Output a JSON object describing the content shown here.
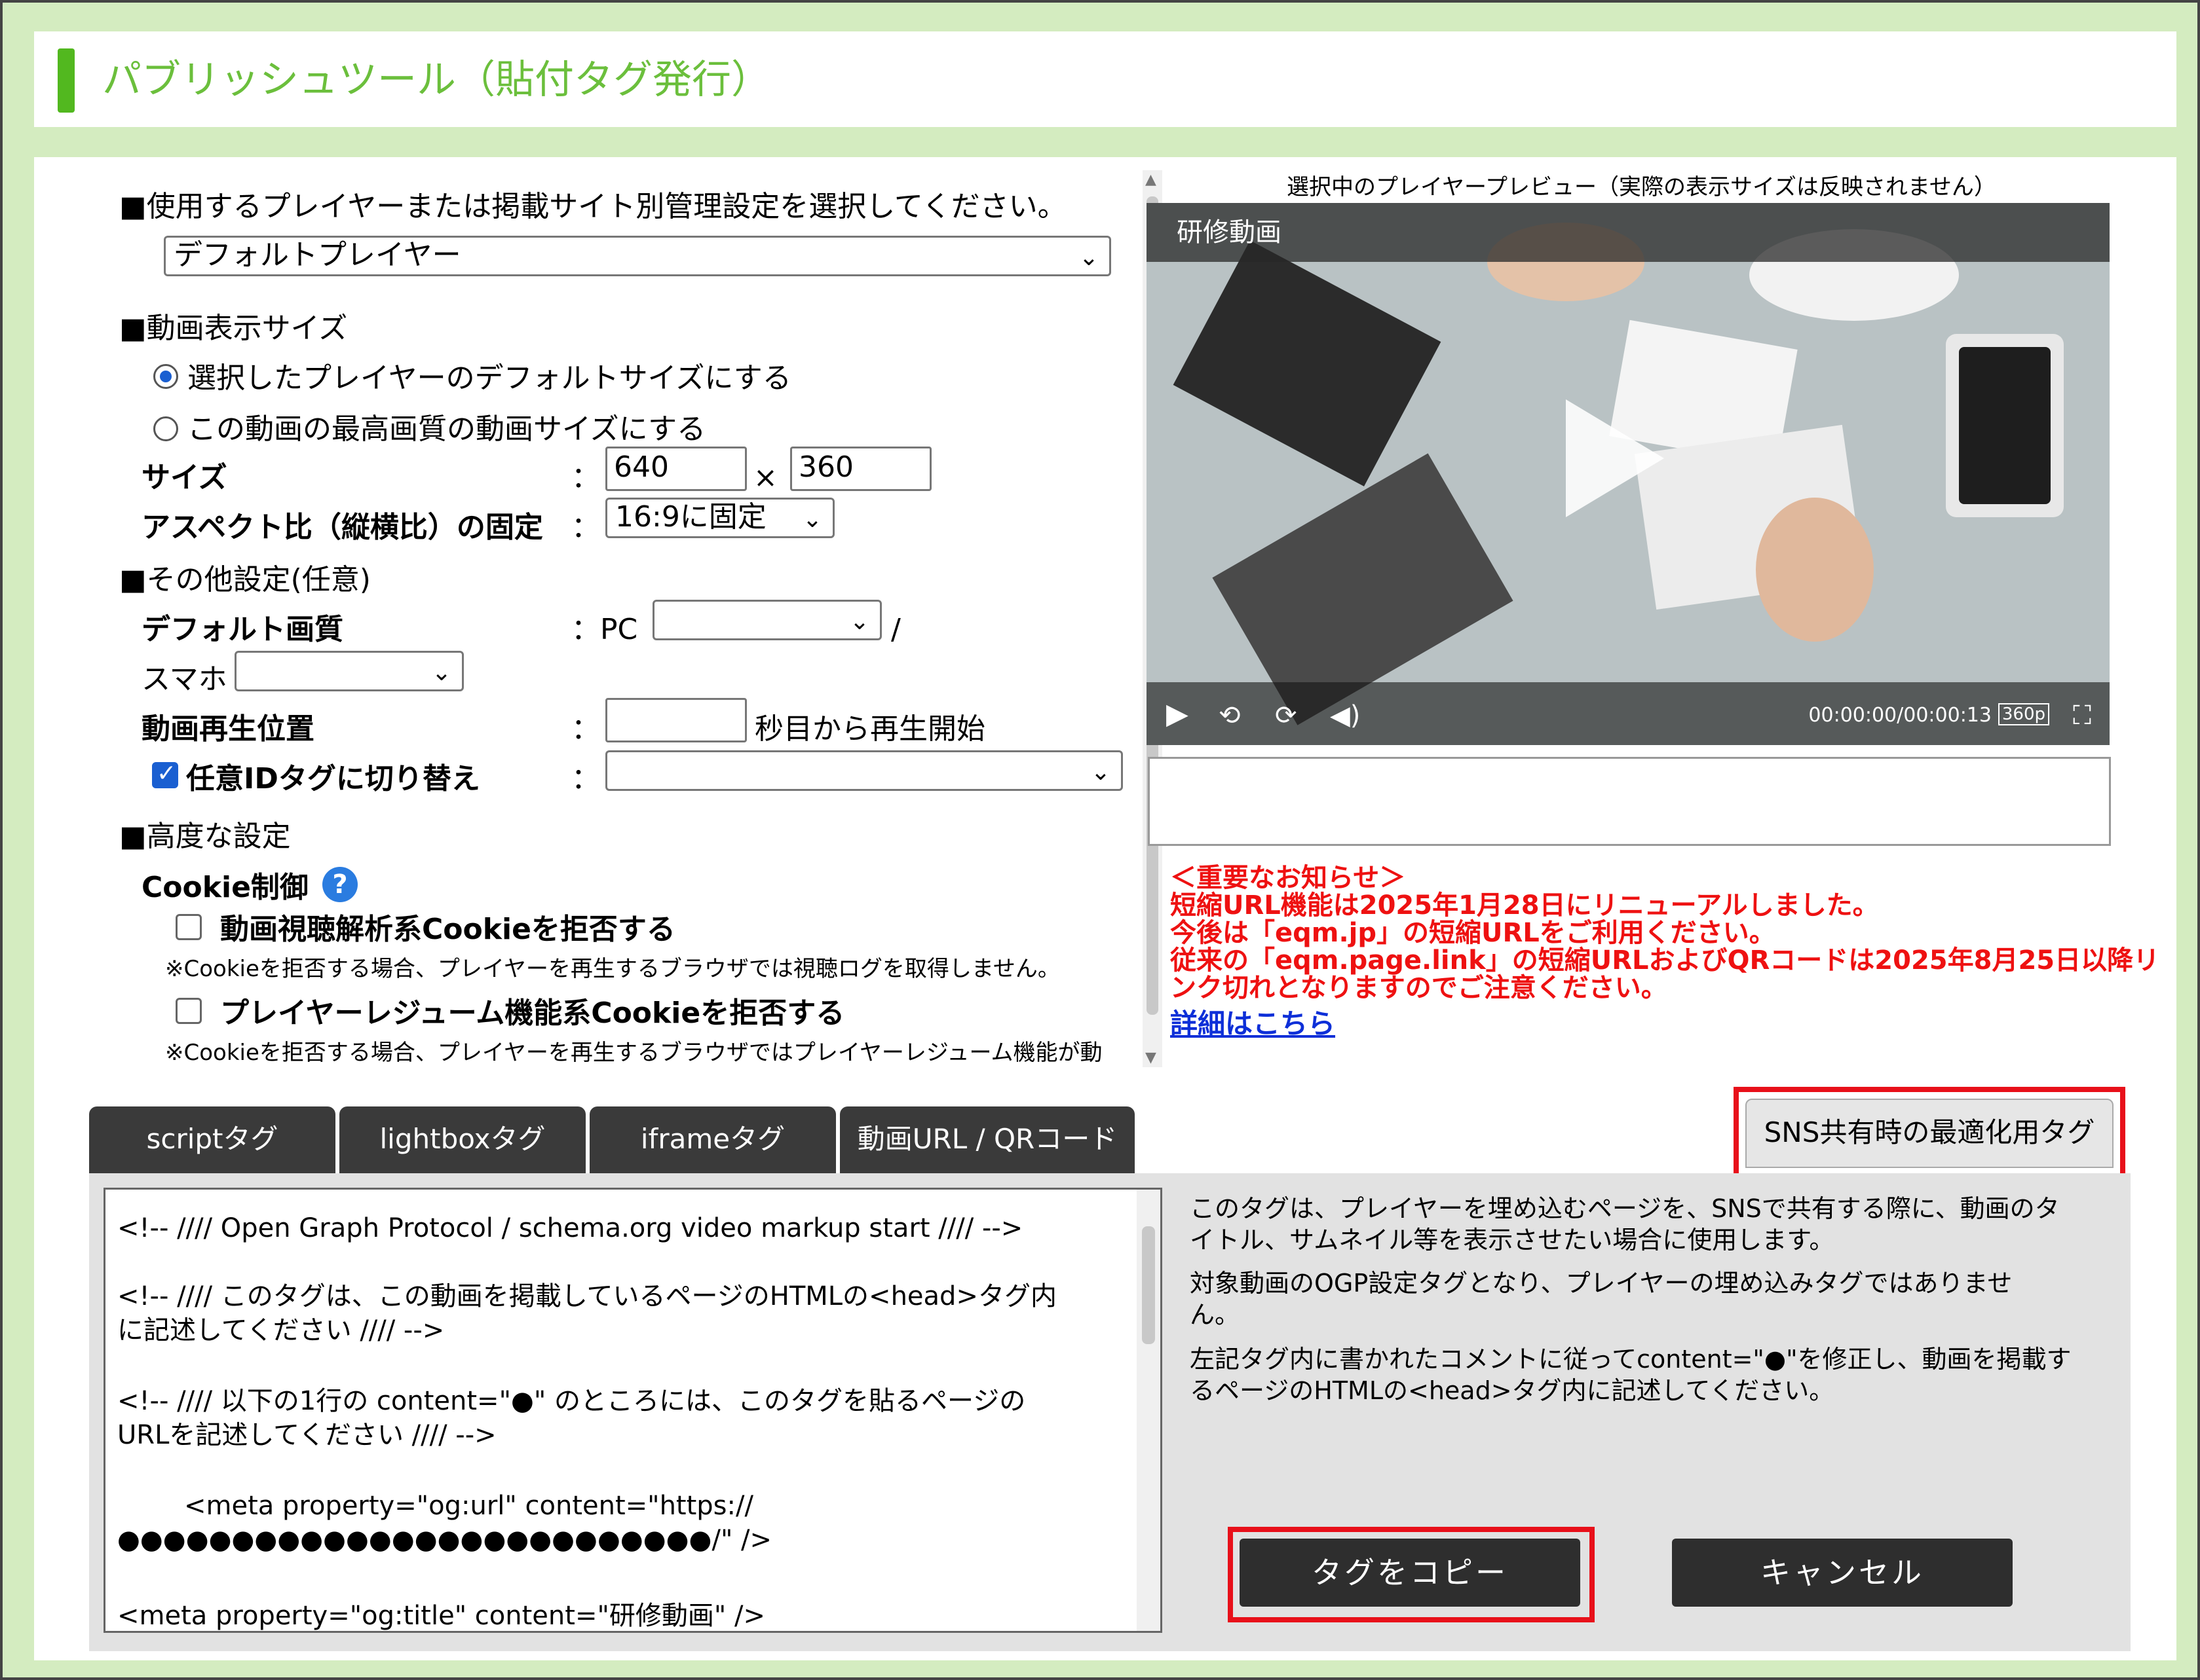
{
  "header": {
    "title": "パブリッシュツール（貼付タグ発行）"
  },
  "player_select": {
    "label": "■使用するプレイヤーまたは掲載サイト別管理設定を選択してください。",
    "value": "デフォルトプレイヤー"
  },
  "display_size": {
    "heading": "■動画表示サイズ",
    "option_default": "選択したプレイヤーのデフォルトサイズにする",
    "option_max": "この動画の最高画質の動画サイズにする",
    "size_label": "サイズ",
    "colon": "：",
    "width": "640",
    "times": "×",
    "height": "360",
    "aspect_label": "アスペクト比（縦横比）の固定",
    "aspect_value": "16:9に固定"
  },
  "other_settings": {
    "heading": "■その他設定(任意)",
    "quality_label": "デフォルト画質",
    "pc_label": "：PC",
    "slash": "/",
    "sp_label": "スマホ",
    "start_label": "動画再生位置",
    "start_suffix": "秒目から再生開始",
    "idtag_label": "任意IDタグに切り替え"
  },
  "advanced": {
    "heading": "■高度な設定",
    "cookie_label": "Cookie制御",
    "help_glyph": "?",
    "opt1_label": "動画視聴解析系Cookieを拒否する",
    "opt1_note": "※Cookieを拒否する場合、プレイヤーを再生するブラウザでは視聴ログを取得しません。",
    "opt2_label": "プレイヤーレジューム機能系Cookieを拒否する",
    "opt2_note": "※Cookieを拒否する場合、プレイヤーを再生するブラウザではプレイヤーレジューム機能が動"
  },
  "preview": {
    "label": "選択中のプレイヤープレビュー（実際の表示サイズは反映されません）",
    "video_title": "研修動画",
    "time": "00:00:00/00:00:13",
    "quality_badge": "360p"
  },
  "notice": {
    "lines": [
      "＜重要なお知らせ＞",
      "短縮URL機能は2025年1月28日にリニューアルしました。",
      "今後は「eqm.jp」の短縮URLをご利用ください。",
      "従来の「eqm.page.link」の短縮URLおよびQRコードは2025年8月25日以降リ",
      "ンク切れとなりますのでご注意ください。"
    ],
    "link": "詳細はこちら"
  },
  "tabs": [
    "scriptタグ",
    "lightboxタグ",
    "iframeタグ",
    "動画URL / QRコード"
  ],
  "sns_tab": "SNS共有時の最適化用タグ",
  "code_lines": [
    "<!-- //// Open Graph Protocol / schema.org video markup start //// -->",
    "<!-- //// このタグは、この動画を掲載しているページのHTMLの<head>タグ内",
    "に記述してください //// -->",
    "<!-- //// 以下の1行の content=\"●\" のところには、このタグを貼るページの",
    "URLを記述してください //// -->",
    "<meta property=\"og:url\" content=\"https://",
    "●●●●●●●●●●●●●●●●●●●●●●●●●●/\" />",
    "<meta property=\"og:title\" content=\"研修動画\" />"
  ],
  "description": [
    "このタグは、プレイヤーを埋め込むページを、SNSで共有する際に、動画のタ",
    "イトル、サムネイル等を表示させたい場合に使用します。",
    "対象動画のOGP設定タグとなり、プレイヤーの埋め込みタグではありませ",
    "ん。",
    "左記タグ内に書かれたコメントに従ってcontent=\"●\"を修正し、動画を掲載す",
    "るページのHTMLの<head>タグ内に記述してください。"
  ],
  "buttons": {
    "copy": "タグをコピー",
    "cancel": "キャンセル"
  },
  "colors": {
    "accent_green": "#52b81f",
    "notice_red": "#ee1111",
    "highlight_red": "#e8101a"
  }
}
